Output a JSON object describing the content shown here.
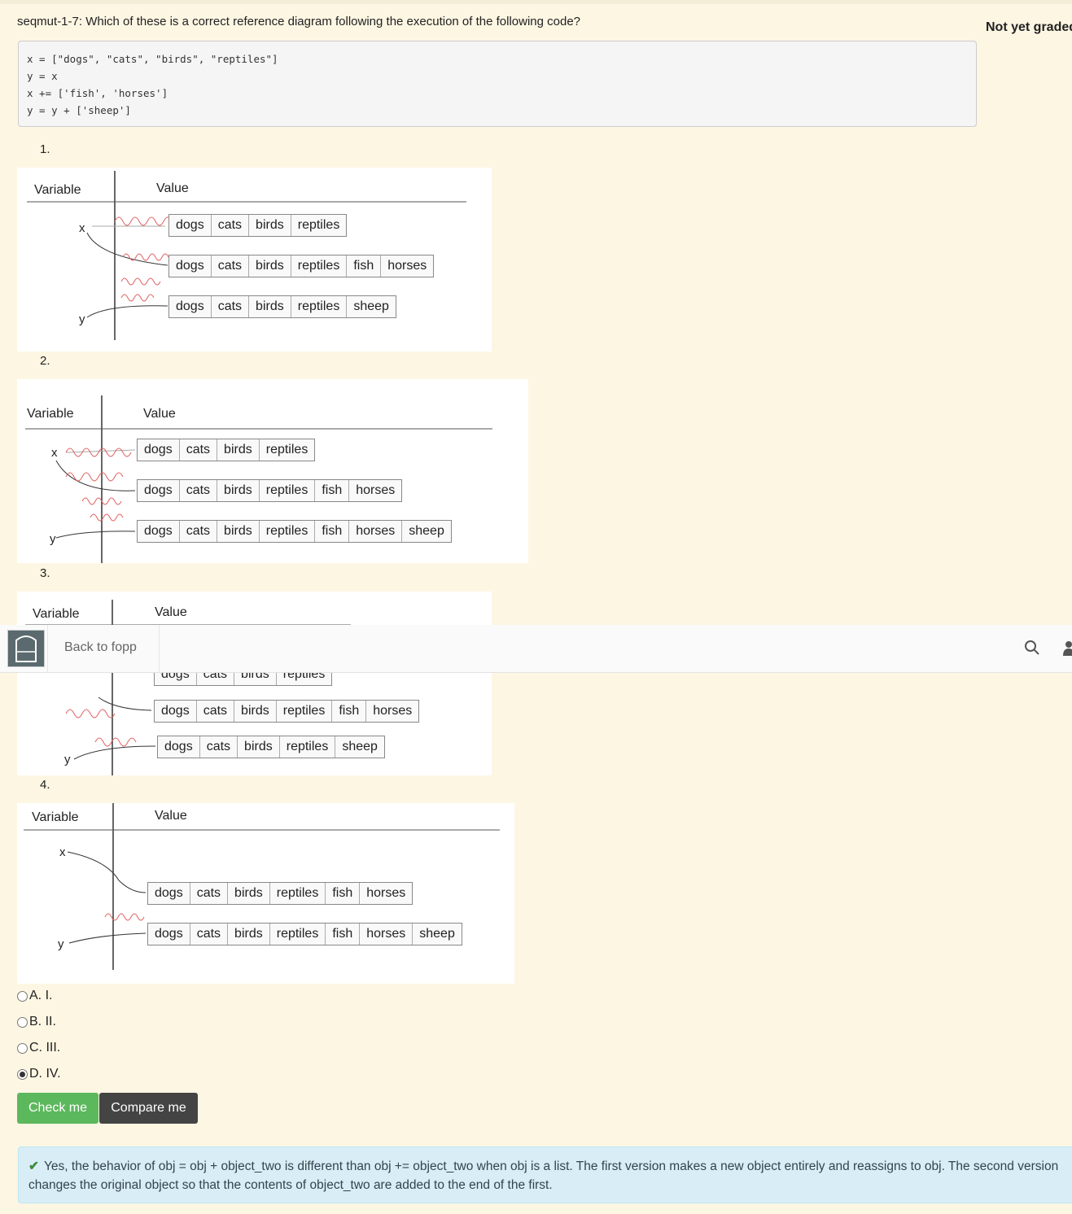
{
  "question": "seqmut-1-7: Which of these is a correct reference diagram following the execution of the following code?",
  "grade_status": "Not yet graded",
  "code_lines": [
    "x = [\"dogs\", \"cats\", \"birds\", \"reptiles\"]",
    "y = x",
    "x += ['fish', 'horses']",
    "y = y + ['sheep']"
  ],
  "diagram_numbers": [
    "1.",
    "2.",
    "3.",
    "4."
  ],
  "diagram_headers": {
    "variable": "Variable",
    "value": "Value"
  },
  "var_labels": {
    "x": "x",
    "y": "y"
  },
  "lists": {
    "base": [
      "dogs",
      "cats",
      "birds",
      "reptiles"
    ],
    "with_fish": [
      "dogs",
      "cats",
      "birds",
      "reptiles",
      "fish",
      "horses"
    ],
    "with_sheep": [
      "dogs",
      "cats",
      "birds",
      "reptiles",
      "sheep"
    ],
    "all": [
      "dogs",
      "cats",
      "birds",
      "reptiles",
      "fish",
      "horses",
      "sheep"
    ]
  },
  "navbar": {
    "back_label": "Back to fopp"
  },
  "choices": [
    {
      "letter": "A.",
      "text": "I.",
      "checked": false
    },
    {
      "letter": "B.",
      "text": "II.",
      "checked": false
    },
    {
      "letter": "C.",
      "text": "III.",
      "checked": false
    },
    {
      "letter": "D.",
      "text": "IV.",
      "checked": true
    }
  ],
  "buttons": {
    "check": "Check me",
    "compare": "Compare me"
  },
  "feedback": "Yes, the behavior of obj = obj + object_two is different than obj += object_two when obj is a list. The first version makes a new object entirely and reassigns to obj. The second version changes the original object so that the contents of object_two are added to the end of the first.",
  "colors": {
    "accent_green": "#5cb85c",
    "dark_button": "#444444",
    "feedback_bg": "#d9edf7",
    "squiggle": "#e06060"
  }
}
